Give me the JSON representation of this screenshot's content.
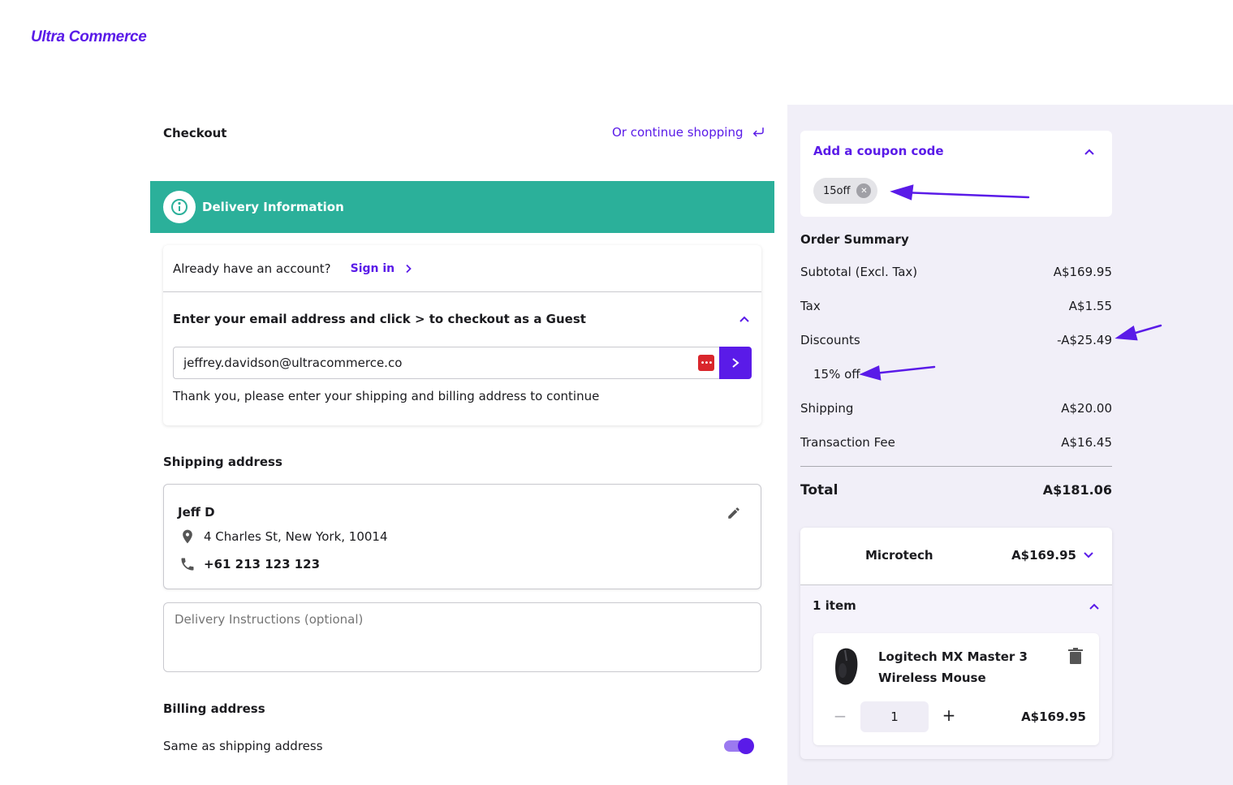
{
  "brand": {
    "logo_text": "Ultra Commerce"
  },
  "header": {
    "checkout_title": "Checkout",
    "continue_shopping": "Or continue shopping"
  },
  "delivery": {
    "section_label": "Delivery Information",
    "account_prompt": "Already have an account?",
    "sign_in_label": "Sign in",
    "guest_prompt": "Enter your email address and click > to checkout as a Guest",
    "email_value": "jeffrey.davidson@ultracommerce.co",
    "confirmation_text": "Thank you, please enter your shipping and billing address to continue"
  },
  "shipping": {
    "title": "Shipping address",
    "name": "Jeff D",
    "address": "4 Charles St, New York, 10014",
    "phone": "+61 213 123 123",
    "instructions_placeholder": "Delivery Instructions (optional)"
  },
  "billing": {
    "title": "Billing address",
    "same_as_label": "Same as shipping address",
    "same_as_enabled": true
  },
  "coupon": {
    "header": "Add a coupon code",
    "applied_code": "15off"
  },
  "summary": {
    "title": "Order Summary",
    "rows": [
      {
        "label": "Subtotal (Excl. Tax)",
        "value": "A$169.95"
      },
      {
        "label": "Tax",
        "value": "A$1.55"
      },
      {
        "label": "Discounts",
        "value": "-A$25.49"
      },
      {
        "label": "Shipping",
        "value": "A$20.00"
      },
      {
        "label": "Transaction Fee",
        "value": "A$16.45"
      }
    ],
    "discount_detail": "15% off",
    "total_label": "Total",
    "total_value": "A$181.06"
  },
  "vendor": {
    "name": "Microtech",
    "price": "A$169.95",
    "items_label": "1 item",
    "product": {
      "name": "Logitech MX Master 3 Wireless Mouse",
      "quantity": "1",
      "price": "A$169.95"
    }
  },
  "colors": {
    "brand": "#5a1be8",
    "delivery_bar": "#2bb09a",
    "panel_bg": "#f1eff8"
  }
}
